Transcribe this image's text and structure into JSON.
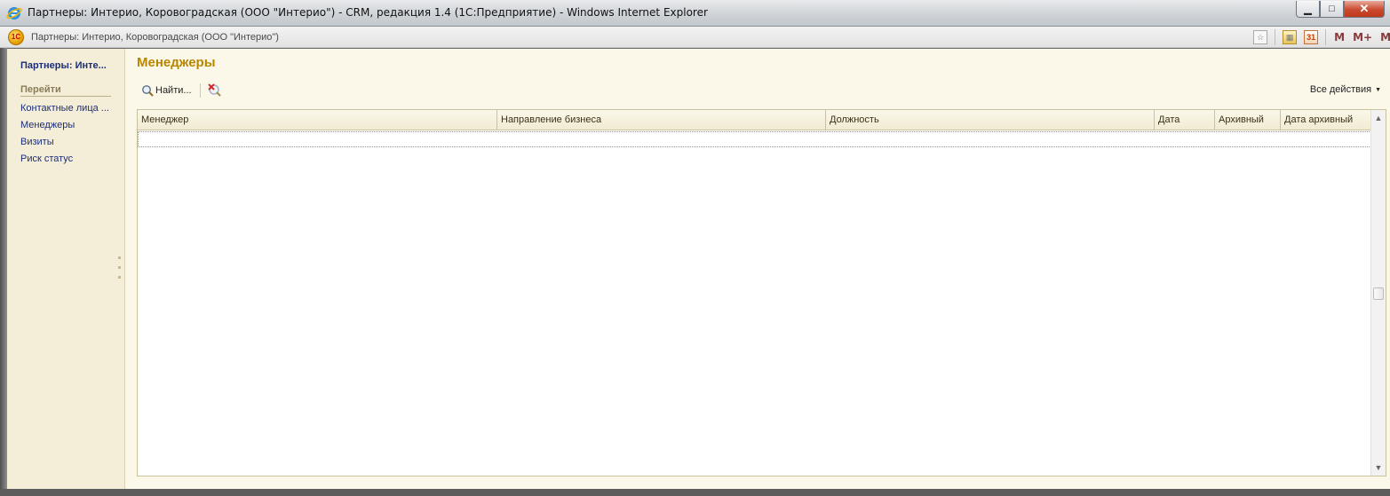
{
  "window": {
    "title": "Партнеры: Интерио, Коровоградская (ООО \"Интерио\") - CRM, редакция 1.4 (1С:Предприятие) - Windows Internet Explorer",
    "minimize": "▁",
    "maximize": "□",
    "close": "✕"
  },
  "appbar": {
    "logo_text": "1С",
    "title": "Партнеры: Интерио, Коровоградская (ООО \"Интерио\")",
    "cal_day": "31",
    "m_label": "M",
    "m_plus_label": "M+",
    "m_minus_label": "M-"
  },
  "sidebar": {
    "heading": "Партнеры: Инте...",
    "goto_label": "Перейти",
    "items": [
      {
        "label": "Контактные лица ..."
      },
      {
        "label": "Менеджеры"
      },
      {
        "label": "Визиты"
      },
      {
        "label": "Риск статус"
      }
    ]
  },
  "main": {
    "title": "Менеджеры",
    "find_label": "Найти...",
    "all_actions_label": "Все действия",
    "table": {
      "columns": [
        "Менеджер",
        "Направление бизнеса",
        "Должность",
        "Дата",
        "Архивный",
        "Дата архивный"
      ],
      "rows": []
    }
  },
  "colors": {
    "title_accent": "#b98600",
    "nav_link": "#1b2d7a",
    "panel_bg": "#f4eed9",
    "main_bg": "#fbf8e9"
  }
}
